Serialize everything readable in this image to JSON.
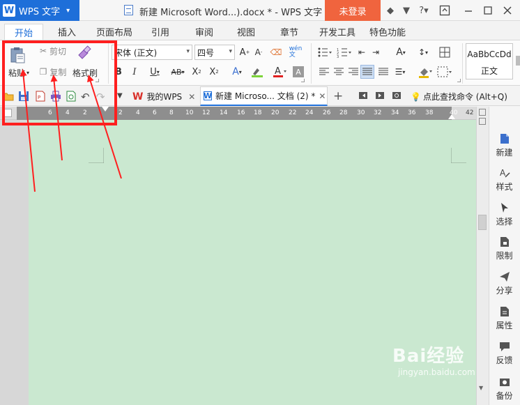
{
  "titlebar": {
    "app_menu": "WPS 文字",
    "title": "新建 Microsoft Word...).docx * - WPS 文字",
    "login": "未登录"
  },
  "tabs": [
    "开始",
    "插入",
    "页面布局",
    "引用",
    "审阅",
    "视图",
    "章节",
    "开发工具",
    "特色功能"
  ],
  "clipboard": {
    "paste": "粘贴",
    "cut": "剪切",
    "copy": "复制",
    "format_painter": "格式刷"
  },
  "font": {
    "family": "宋体 (正文)",
    "size": "四号"
  },
  "style_gallery": {
    "preview": "AaBbCcDd",
    "name": "正文"
  },
  "doc_tabs": {
    "my_wps": "我的WPS",
    "current": "新建 Microso... 文档 (2) *"
  },
  "search_command": "点此查找命令 (Alt+Q)",
  "ruler": {
    "left_numbers": [
      "6",
      "4",
      "2"
    ],
    "right_numbers": [
      "2",
      "4",
      "6",
      "8",
      "10",
      "12",
      "14",
      "16",
      "18",
      "20",
      "22",
      "24",
      "26",
      "28",
      "30",
      "32",
      "34",
      "36",
      "38",
      "40",
      "42"
    ]
  },
  "taskpane": [
    "新建",
    "样式",
    "选择",
    "限制",
    "分享",
    "属性",
    "反馈",
    "备份"
  ],
  "watermark": {
    "brand": "Bai经验",
    "url": "jingyan.baidu.com"
  },
  "colors": {
    "accent": "#1e6fd9",
    "login_button": "#f0643e",
    "page_background": "#cae8d0",
    "annotation": "#ff1f1f"
  }
}
